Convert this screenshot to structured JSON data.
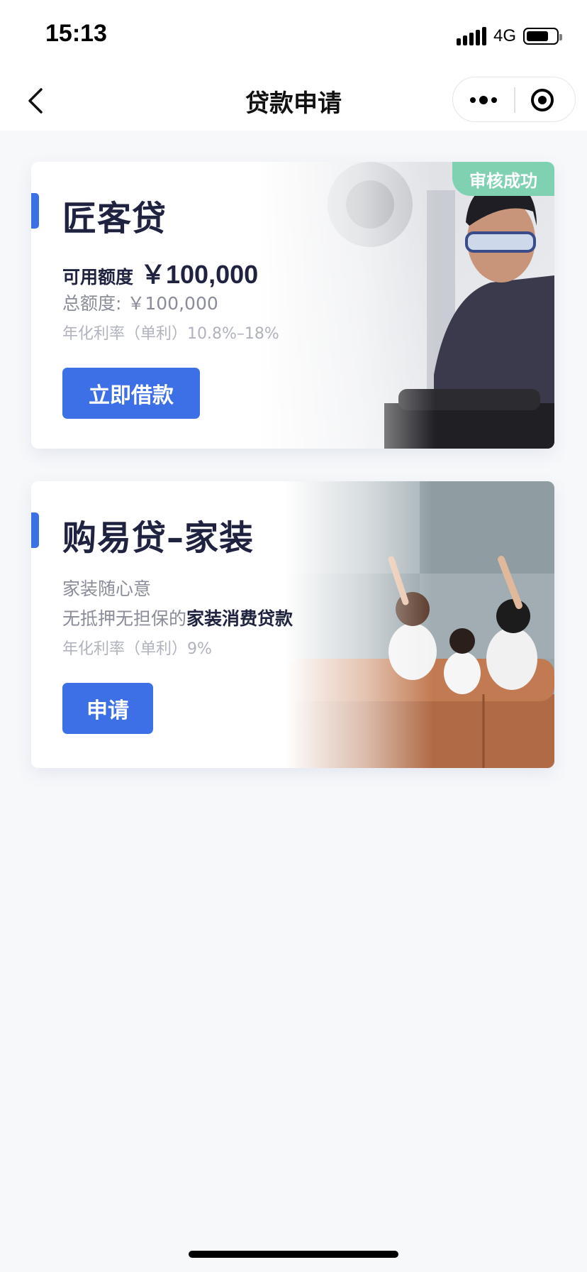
{
  "status_bar": {
    "time": "15:13",
    "network": "4G",
    "battery_level": 0.75
  },
  "nav": {
    "title": "贷款申请"
  },
  "cards": [
    {
      "title": "匠客贷",
      "badge": "审核成功",
      "available_label": "可用额度",
      "available_amount": "￥100,000",
      "total_line": "总额度: ￥100,000",
      "rate_line": "年化利率（单利）10.8%–18%",
      "button": "立即借款",
      "image": "engineer-photo"
    },
    {
      "title": "购易贷–家装",
      "line1": "家装随心意",
      "line2_prefix": "无抵押无担保的",
      "line2_bold": "家装消费贷款",
      "rate_line": "年化利率（单利）9%",
      "button": "申请",
      "image": "family-on-sofa-photo"
    }
  ],
  "colors": {
    "accent": "#3d6fe6",
    "badge": "#7fd1b2",
    "title": "#1f2340"
  }
}
